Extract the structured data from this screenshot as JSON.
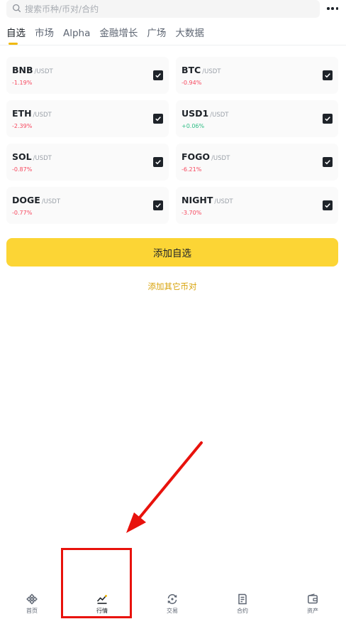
{
  "search": {
    "placeholder": "搜索币种/币对/合约"
  },
  "tabs": [
    {
      "label": "自选",
      "active": true
    },
    {
      "label": "市场"
    },
    {
      "label": "Alpha"
    },
    {
      "label": "金融增长"
    },
    {
      "label": "广场"
    },
    {
      "label": "大数据"
    }
  ],
  "pairs": [
    {
      "base": "BNB",
      "quote": "/USDT",
      "change": "-1.19%",
      "checked": true
    },
    {
      "base": "BTC",
      "quote": "/USDT",
      "change": "-0.94%",
      "checked": true
    },
    {
      "base": "ETH",
      "quote": "/USDT",
      "change": "-2.39%",
      "checked": true
    },
    {
      "base": "USD1",
      "quote": "/USDT",
      "change": "+0.06%",
      "checked": true
    },
    {
      "base": "SOL",
      "quote": "/USDT",
      "change": "-0.87%",
      "checked": true
    },
    {
      "base": "FOGO",
      "quote": "/USDT",
      "change": "-6.21%",
      "checked": true
    },
    {
      "base": "DOGE",
      "quote": "/USDT",
      "change": "-0.77%",
      "checked": true
    },
    {
      "base": "NIGHT",
      "quote": "/USDT",
      "change": "-3.70%",
      "checked": true
    }
  ],
  "actions": {
    "add_label": "添加自选",
    "add_other_label": "添加其它币对"
  },
  "bottom_nav": [
    {
      "label": "首页",
      "icon": "home-icon"
    },
    {
      "label": "行情",
      "icon": "markets-icon",
      "active": true
    },
    {
      "label": "交易",
      "icon": "trade-icon"
    },
    {
      "label": "合约",
      "icon": "futures-icon"
    },
    {
      "label": "资产",
      "icon": "wallet-icon"
    }
  ],
  "colors": {
    "brand": "#fcd535",
    "accent_text": "#d8a30b",
    "down": "#f6465d",
    "up": "#2ebd85",
    "annotation": "#e8120c"
  }
}
